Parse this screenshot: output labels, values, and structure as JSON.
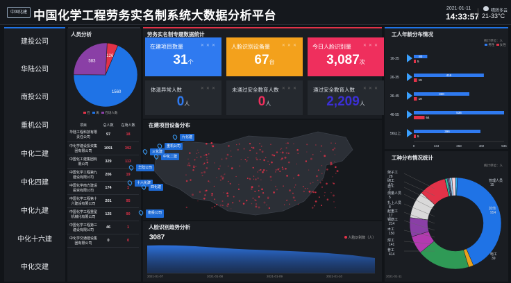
{
  "header": {
    "logo_text": "中国化建",
    "title": "中国化学工程劳务实名制系统大数据分析平台",
    "date": "2021-01-11",
    "time": "14:33:57",
    "weather": "晴转多云",
    "temperature": "21-33°C"
  },
  "companies": [
    "建投公司",
    "华陆公司",
    "南投公司",
    "重机公司",
    "中化二建",
    "中化四建",
    "中化九建",
    "中化十六建",
    "中化交建"
  ],
  "personnel": {
    "title": "人员分析",
    "pie": [
      {
        "label": "在",
        "value": 126,
        "color": "#e23248"
      },
      {
        "label": "离",
        "value": 1560,
        "color": "#1f73e6"
      },
      {
        "label": "在场人数",
        "value": 583,
        "color": "#8a3fa6"
      }
    ],
    "legend": [
      "在",
      "离",
      "在场人数"
    ],
    "headers": [
      "项目",
      "总人数",
      "在场人数"
    ],
    "rows": [
      {
        "name": "华陆工程科技有限责任公司",
        "total": "97",
        "onsite": "18"
      },
      {
        "name": "中化学建设投资集团有限公司",
        "total": "1091",
        "onsite": "392"
      },
      {
        "name": "中国化工建集团有限公司",
        "total": "329",
        "onsite": "113"
      },
      {
        "name": "中国化学工程第九建设有限公司",
        "total": "206",
        "onsite": "19"
      },
      {
        "name": "中国化学南方建设投资有限公司",
        "total": "174",
        "onsite": "1"
      },
      {
        "name": "中国化学工程第十六建设有限公司",
        "total": "201",
        "onsite": "95"
      },
      {
        "name": "中国化学工程重型机械化有限公司",
        "total": "125",
        "onsite": "90"
      },
      {
        "name": "中国化学工程第三建设有限公司",
        "total": "46",
        "onsite": "1"
      },
      {
        "name": "中化学交通建设集团有限公司",
        "total": "0",
        "onsite": "0"
      }
    ]
  },
  "stats": {
    "title": "劳务实名制专题数据统计",
    "cards": [
      {
        "label": "在建项目数量",
        "value": "31",
        "unit": "个",
        "color": "#2f7af0"
      },
      {
        "label": "人脸识别设备量",
        "value": "67",
        "unit": "台",
        "color": "#f3a11c"
      },
      {
        "label": "今日人脸识别量",
        "value": "3,087",
        "unit": "次",
        "color": "#ef2f5d"
      }
    ],
    "dark_cards": [
      {
        "label": "体温异常人数",
        "value": "0",
        "unit": "人",
        "color": "#2f7af0"
      },
      {
        "label": "未通过安全教育人数",
        "value": "0",
        "unit": "人",
        "color": "#ef2f5d"
      },
      {
        "label": "通过安全教育人数",
        "value": "2,209",
        "unit": "人",
        "color": "#3b2fd6"
      }
    ]
  },
  "map": {
    "title": "在建项目设备分布",
    "tags": [
      "九化建",
      "重机公司",
      "三化建",
      "中化二建",
      "华陆公司",
      "十六化建",
      "四化建",
      "南投公司"
    ]
  },
  "trend": {
    "title": "人脸识别趋势分析",
    "value": "3087",
    "legend": "人脸识别数（人）"
  },
  "age": {
    "title": "工人年龄分布情况",
    "unit": "统计单位：人",
    "legend": [
      "男性",
      "女性"
    ],
    "colors": {
      "male": "#2f7af0",
      "female": "#e23248"
    },
    "xticks": [
      "0",
      "134",
      "268",
      "402",
      "536"
    ],
    "chart_data": {
      "type": "bar",
      "categories": [
        "16-25",
        "26-35",
        "36-45",
        "46-55",
        "56以上"
      ],
      "series": [
        {
          "name": "男性",
          "values": [
            80,
            416,
            330,
            536,
            396
          ]
        },
        {
          "name": "女性",
          "values": [
            5,
            19,
            19,
            64,
            5
          ]
        }
      ],
      "xlim": [
        0,
        536
      ]
    }
  },
  "trade": {
    "title": "工种分布情况统计",
    "unit": "统计单位：人",
    "chart_data": {
      "type": "pie",
      "labels": [
        "管理人员",
        "其他",
        "电工",
        "普工",
        "焊工",
        "木工",
        "钢筋工",
        "瓦工",
        "架子工",
        "起重工",
        "扎上人员",
        "测量人员",
        "自工",
        "砌工",
        "架子工"
      ],
      "values": [
        15,
        954,
        39,
        414,
        141,
        150,
        214,
        214,
        1,
        17,
        8,
        5,
        7,
        17,
        28
      ]
    },
    "colors": [
      "#2aa8e6",
      "#1f73e6",
      "#e8a21d",
      "#2f9a56",
      "#b33ab0",
      "#8a3fa6",
      "#d9d9d9",
      "#e23248",
      "#f0c419",
      "#35c0a0",
      "#5a7fd8",
      "#b0b0b0",
      "#c9a0e0",
      "#9bd1f2",
      "#f6d6e0"
    ],
    "labels_left": [
      {
        "n": "架子工",
        "v": "28"
      },
      {
        "n": "砌工",
        "v": "17"
      },
      {
        "n": "自工",
        "v": "7"
      },
      {
        "n": "测量人员",
        "v": "5"
      },
      {
        "n": "扎上人员",
        "v": "8"
      },
      {
        "n": "起重工",
        "v": "17"
      },
      {
        "n": "钢筋工",
        "v": "214"
      },
      {
        "n": "木工",
        "v": "150"
      },
      {
        "n": "焊工",
        "v": "141"
      },
      {
        "n": "普工",
        "v": "414"
      }
    ],
    "labels_right": [
      {
        "n": "管理人员",
        "v": "15"
      },
      {
        "n": "其他",
        "v": "954"
      },
      {
        "n": "电工",
        "v": "39"
      }
    ]
  }
}
